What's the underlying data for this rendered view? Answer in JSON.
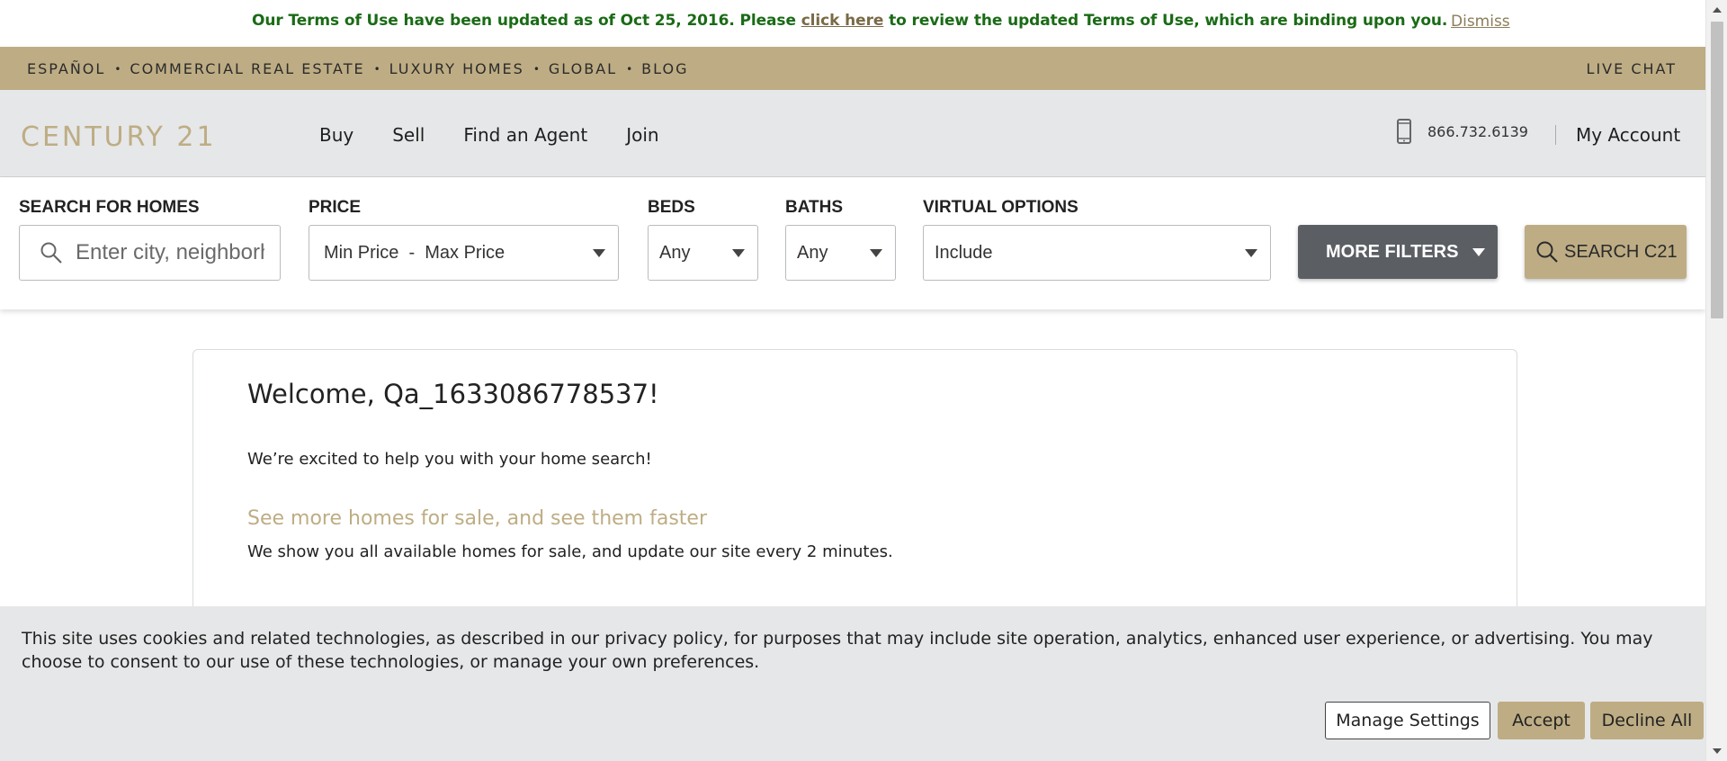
{
  "terms_banner": {
    "text_before": "Our Terms of Use have been updated as of Oct 25, 2016. Please ",
    "link": "click here",
    "text_after": " to review the updated Terms of Use, which are binding upon you.",
    "dismiss": "Dismiss"
  },
  "utility_nav": {
    "items": [
      "ESPAÑOL",
      "COMMERCIAL REAL ESTATE",
      "LUXURY HOMES",
      "GLOBAL",
      "BLOG"
    ],
    "separator": "•",
    "live_chat": "LIVE CHAT"
  },
  "header": {
    "logo": "CENTURY 21",
    "nav": [
      "Buy",
      "Sell",
      "Find an Agent",
      "Join"
    ],
    "phone": "866.732.6139",
    "phone_icon": "mobile-phone-icon",
    "account": "My Account"
  },
  "search": {
    "location_label": "SEARCH FOR HOMES",
    "location_placeholder": "Enter city, neighborhood, address, ZIP",
    "price_label": "PRICE",
    "price_value": "Min Price  -  Max Price",
    "beds_label": "BEDS",
    "beds_value": "Any",
    "baths_label": "BATHS",
    "baths_value": "Any",
    "virtual_label": "VIRTUAL OPTIONS",
    "virtual_value": "Include",
    "more_filters": "MORE FILTERS",
    "search_button": "SEARCH C21"
  },
  "welcome": {
    "title": "Welcome, Qa_1633086778537!",
    "intro": "We’re excited to help you with your home search!",
    "heading": "See more homes for sale, and see them faster",
    "description": "We show you all available homes for sale, and update our site every 2 minutes."
  },
  "cookie": {
    "text": "This site uses cookies and related technologies, as described in our privacy policy, for purposes that may include site operation, analytics, enhanced user experience, or advertising. You may choose to consent to our use of these technologies, or manage your own preferences.",
    "manage": "Manage Settings",
    "accept": "Accept",
    "decline": "Decline All"
  },
  "colors": {
    "gold": "#bead84",
    "header_gray": "#e6e7e9",
    "terms_green": "#1a6b16",
    "filter_dark": "#5b5f64"
  }
}
